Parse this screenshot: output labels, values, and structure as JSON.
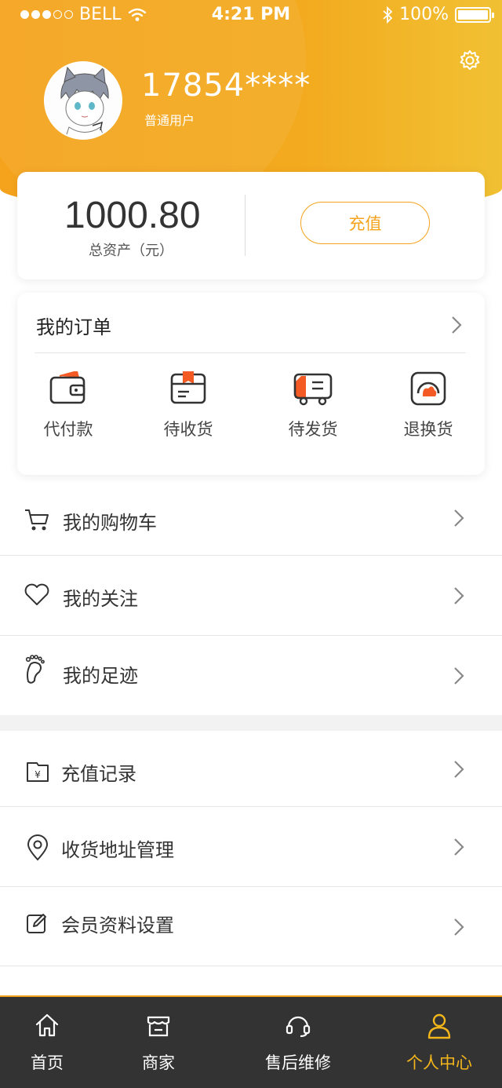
{
  "status_bar": {
    "carrier": "BELL",
    "time": "4:21 PM",
    "battery": "100%"
  },
  "profile": {
    "username": "17854****",
    "level": "普通用户"
  },
  "assets": {
    "amount": "1000.80",
    "label": "总资产（元）",
    "recharge_label": "充值"
  },
  "orders": {
    "title": "我的订单",
    "items": [
      {
        "label": "代付款",
        "icon": "wallet-icon"
      },
      {
        "label": "待收货",
        "icon": "package-icon"
      },
      {
        "label": "待发货",
        "icon": "truck-icon"
      },
      {
        "label": "退换货",
        "icon": "return-icon"
      }
    ]
  },
  "menu": {
    "group1": [
      {
        "label": "我的购物车",
        "icon": "cart-icon"
      },
      {
        "label": "我的关注",
        "icon": "heart-icon"
      },
      {
        "label": "我的足迹",
        "icon": "footprint-icon"
      }
    ],
    "group2": [
      {
        "label": "充值记录",
        "icon": "recharge-record-icon"
      },
      {
        "label": "收货地址管理",
        "icon": "location-icon"
      },
      {
        "label": "会员资料设置",
        "icon": "edit-icon"
      }
    ]
  },
  "tabbar": [
    {
      "label": "首页",
      "icon": "home-icon"
    },
    {
      "label": "商家",
      "icon": "store-icon"
    },
    {
      "label": "售后维修",
      "icon": "headset-icon"
    },
    {
      "label": "个人中心",
      "icon": "user-icon",
      "active": true
    }
  ],
  "colors": {
    "accent": "#f5a31c",
    "tabbar_bg": "#333333",
    "active_tab": "#f5b61c",
    "icon_highlight": "#f45a24"
  }
}
